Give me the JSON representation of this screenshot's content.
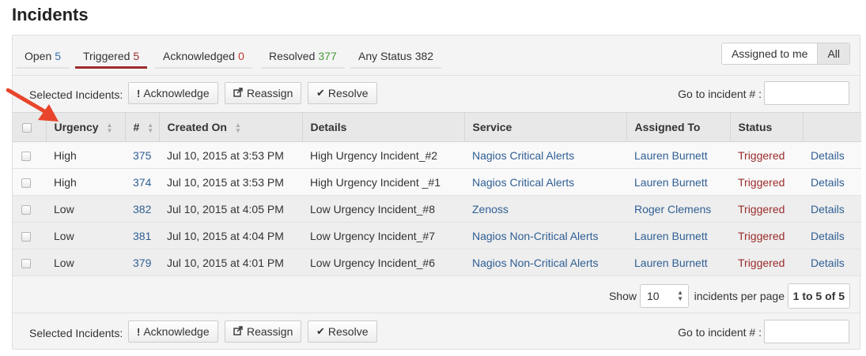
{
  "page": {
    "title": "Incidents"
  },
  "tabs": [
    {
      "label": "Open",
      "count": "5"
    },
    {
      "label": "Triggered",
      "count": "5"
    },
    {
      "label": "Acknowledged",
      "count": "0"
    },
    {
      "label": "Resolved",
      "count": "377"
    },
    {
      "label": "Any Status",
      "count": "382"
    }
  ],
  "assignment": {
    "assigned_to_me": "Assigned to me",
    "all": "All"
  },
  "actions": {
    "selected_label": "Selected Incidents:",
    "acknowledge": "Acknowledge",
    "reassign": "Reassign",
    "resolve": "Resolve",
    "goto_label": "Go to incident # :",
    "goto_value": ""
  },
  "table": {
    "headers": [
      "Urgency",
      "#",
      "Created On",
      "Details",
      "Service",
      "Assigned To",
      "Status",
      ""
    ],
    "rows": [
      {
        "urgency": "High",
        "number": "375",
        "created": "Jul 10, 2015 at 3:53 PM",
        "details": "High Urgency Incident_#2",
        "service": "Nagios Critical Alerts",
        "assigned": "Lauren Burnett",
        "status": "Triggered",
        "link": "Details"
      },
      {
        "urgency": "High",
        "number": "374",
        "created": "Jul 10, 2015 at 3:53 PM",
        "details": "High Urgency Incident _#1",
        "service": "Nagios Critical Alerts",
        "assigned": "Lauren Burnett",
        "status": "Triggered",
        "link": "Details"
      },
      {
        "urgency": "Low",
        "number": "382",
        "created": "Jul 10, 2015 at 4:05 PM",
        "details": "Low Urgency Incident_#8",
        "service": "Zenoss",
        "assigned": "Roger Clemens",
        "status": "Triggered",
        "link": "Details"
      },
      {
        "urgency": "Low",
        "number": "381",
        "created": "Jul 10, 2015 at 4:04 PM",
        "details": "Low Urgency Incident_#7",
        "service": "Nagios Non-Critical Alerts",
        "assigned": "Lauren Burnett",
        "status": "Triggered",
        "link": "Details"
      },
      {
        "urgency": "Low",
        "number": "379",
        "created": "Jul 10, 2015 at 4:01 PM",
        "details": "Low Urgency Incident_#6",
        "service": "Nagios Non-Critical Alerts",
        "assigned": "Lauren Burnett",
        "status": "Triggered",
        "link": "Details"
      }
    ]
  },
  "pagination": {
    "show_label": "Show",
    "per_page_value": "10",
    "per_page_label": "incidents per page",
    "range": "1 to 5 of 5"
  },
  "colors": {
    "accent_triggered": "#9b2b2b",
    "link": "#2f5f94",
    "annotation_arrow": "#e8452c"
  },
  "icons": {
    "acknowledge": "exclamation-icon",
    "reassign": "share-icon",
    "resolve": "checkmark-icon"
  }
}
